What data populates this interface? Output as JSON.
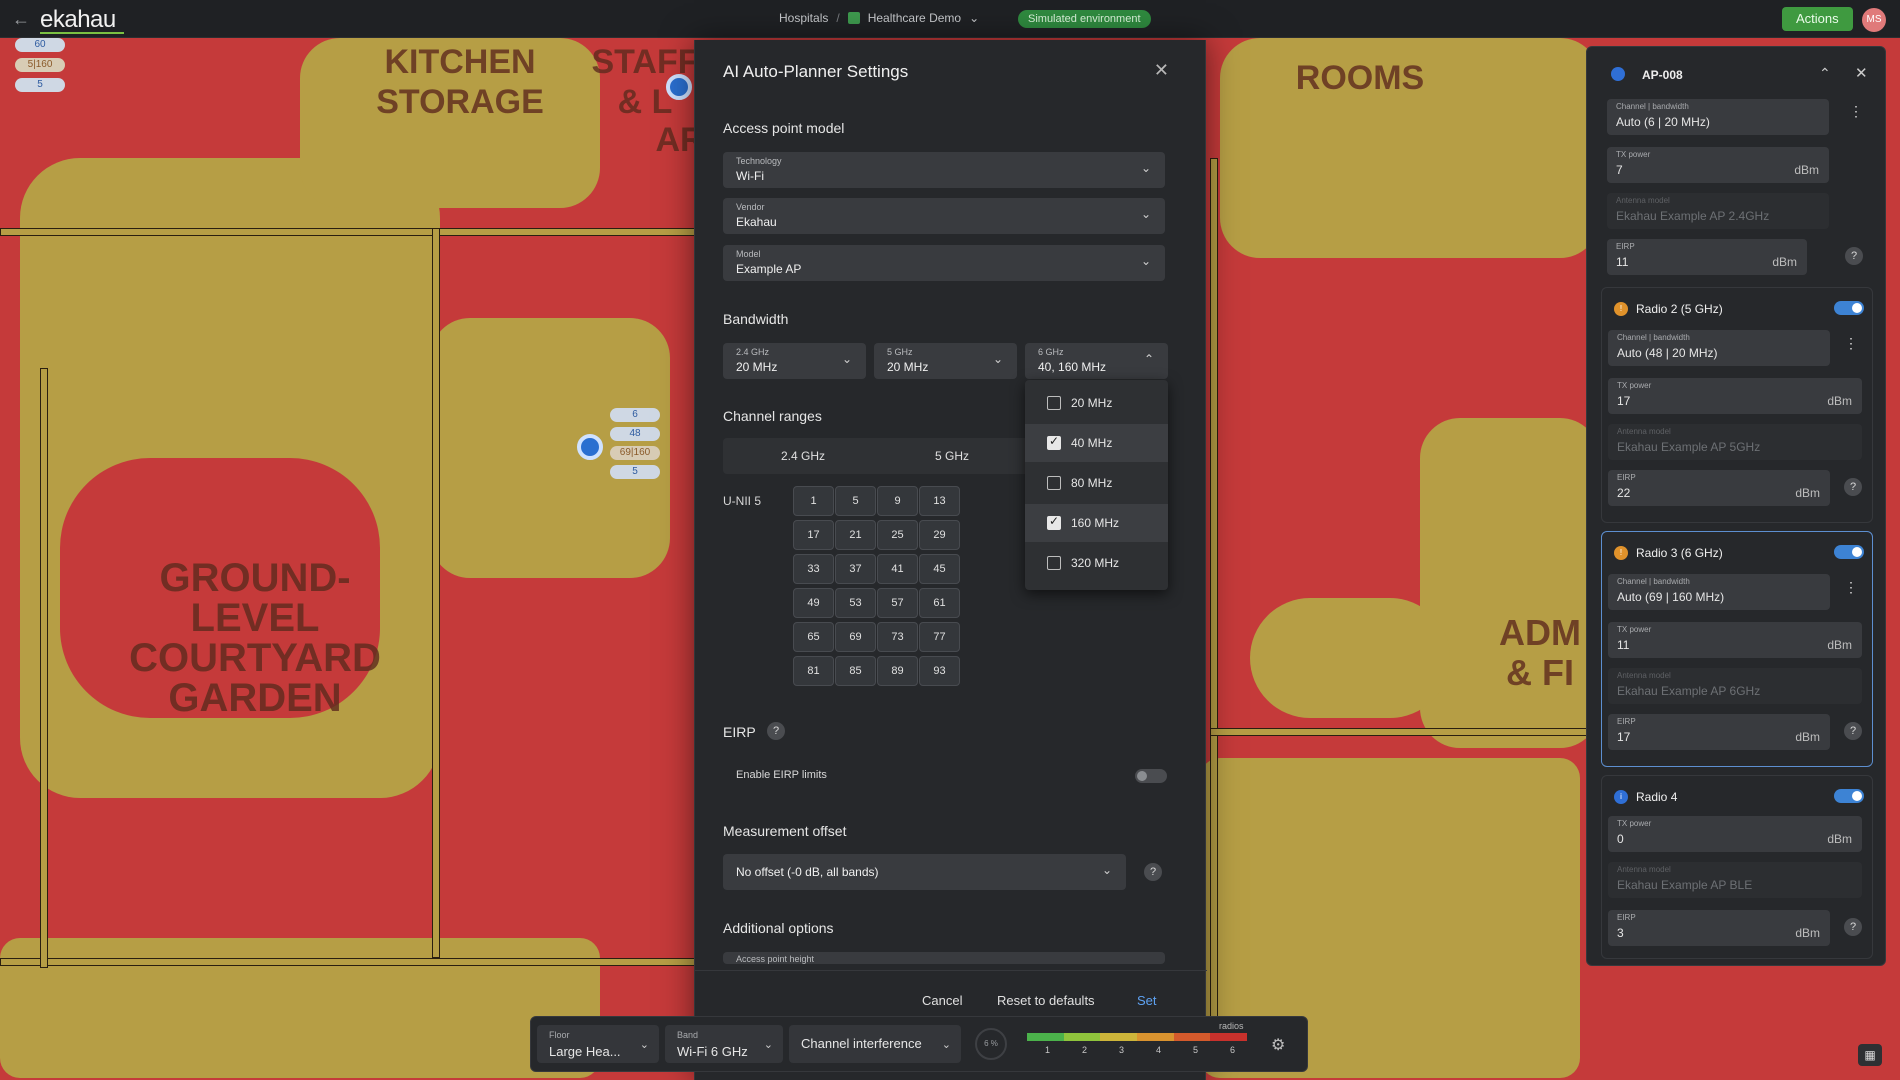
{
  "app": {
    "name": "ekahau",
    "back_icon": "arrow-left-icon"
  },
  "breadcrumb": {
    "project": "Hospitals",
    "separator": "/",
    "file": "Healthcare Demo"
  },
  "environment_badge": "Simulated environment",
  "actions_label": "Actions",
  "avatar_initials": "MS",
  "map": {
    "labels": [
      "KITCHEN STORAGE",
      "STAFF & L",
      "AR",
      "GROUND-LEVEL COURTYARD GARDEN",
      "ROOMS",
      "ADM & FI"
    ],
    "ap_tags_left": [
      "60",
      "5|160",
      "5"
    ],
    "ap_tags_center": [
      "6",
      "48",
      "69|160",
      "5"
    ]
  },
  "modal": {
    "title": "AI Auto-Planner Settings",
    "close_icon": "close-icon",
    "ap_model_heading": "Access point model",
    "technology": {
      "label": "Technology",
      "value": "Wi-Fi"
    },
    "vendor": {
      "label": "Vendor",
      "value": "Ekahau"
    },
    "model": {
      "label": "Model",
      "value": "Example AP"
    },
    "bandwidth_heading": "Bandwidth",
    "bw_24": {
      "label": "2.4 GHz",
      "value": "20 MHz"
    },
    "bw_5": {
      "label": "5 GHz",
      "value": "20 MHz"
    },
    "bw_6": {
      "label": "6 GHz",
      "value": "40, 160 MHz"
    },
    "bw_options": [
      {
        "label": "20 MHz",
        "checked": false
      },
      {
        "label": "40 MHz",
        "checked": true
      },
      {
        "label": "80 MHz",
        "checked": false
      },
      {
        "label": "160 MHz",
        "checked": true
      },
      {
        "label": "320 MHz",
        "checked": false
      }
    ],
    "channel_ranges_heading": "Channel ranges",
    "band_tabs": [
      "2.4 GHz",
      "5 GHz"
    ],
    "unii_label": "U-NII 5",
    "channels": [
      "1",
      "5",
      "9",
      "13",
      "17",
      "21",
      "25",
      "29",
      "33",
      "37",
      "41",
      "45",
      "49",
      "53",
      "57",
      "61",
      "65",
      "69",
      "73",
      "77",
      "81",
      "85",
      "89",
      "93"
    ],
    "eirp_heading": "EIRP",
    "eirp_toggle_label": "Enable EIRP limits",
    "eirp_enabled": false,
    "measurement_heading": "Measurement offset",
    "measurement_value": "No offset (-0 dB, all bands)",
    "additional_heading": "Additional options",
    "ap_height_label": "Access point height",
    "cancel": "Cancel",
    "reset": "Reset to defaults",
    "set": "Set"
  },
  "ap_panel": {
    "title": "AP-008",
    "radio1": {
      "channel_label": "Channel | bandwidth",
      "channel_value": "Auto (6 | 20 MHz)",
      "tx_label": "TX power",
      "tx_value": "7",
      "tx_unit": "dBm",
      "antenna_label": "Antenna model",
      "antenna_value": "Ekahau Example AP 2.4GHz",
      "eirp_label": "EIRP",
      "eirp_value": "11",
      "eirp_unit": "dBm"
    },
    "radio2": {
      "name": "Radio 2 (5 GHz)",
      "badge": "!",
      "enabled": true,
      "channel_label": "Channel | bandwidth",
      "channel_value": "Auto (48 | 20 MHz)",
      "tx_label": "TX power",
      "tx_value": "17",
      "tx_unit": "dBm",
      "antenna_label": "Antenna model",
      "antenna_value": "Ekahau Example AP 5GHz",
      "eirp_label": "EIRP",
      "eirp_value": "22",
      "eirp_unit": "dBm"
    },
    "radio3": {
      "name": "Radio 3 (6 GHz)",
      "badge": "!",
      "enabled": true,
      "channel_label": "Channel | bandwidth",
      "channel_value": "Auto (69 | 160 MHz)",
      "tx_label": "TX power",
      "tx_value": "11",
      "tx_unit": "dBm",
      "antenna_label": "Antenna model",
      "antenna_value": "Ekahau Example AP 6GHz",
      "eirp_label": "EIRP",
      "eirp_value": "17",
      "eirp_unit": "dBm"
    },
    "radio4": {
      "name": "Radio 4",
      "badge": "i",
      "enabled": true,
      "tx_label": "TX power",
      "tx_value": "0",
      "tx_unit": "dBm",
      "antenna_label": "Antenna model",
      "antenna_value": "Ekahau Example AP BLE",
      "eirp_label": "EIRP",
      "eirp_value": "3",
      "eirp_unit": "dBm"
    }
  },
  "bottom": {
    "floor_label": "Floor",
    "floor_value": "Large Hea...",
    "band_label": "Band",
    "band_value": "Wi-Fi 6 GHz",
    "view_value": "Channel interference",
    "percent": "6 %",
    "legend_title": "radios",
    "legend_numbers": [
      "1",
      "2",
      "3",
      "4",
      "5",
      "6"
    ],
    "legend_colors": [
      "#4bb24b",
      "#8fc43c",
      "#cdb53a",
      "#d9932f",
      "#d45a2c",
      "#c8312c"
    ]
  }
}
